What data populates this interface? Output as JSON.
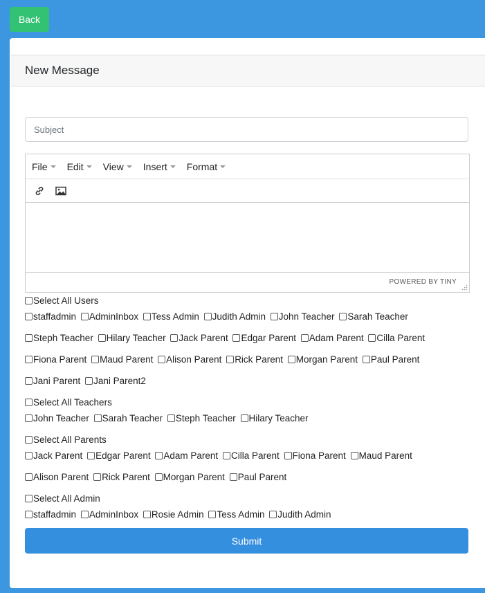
{
  "back_label": "Back",
  "card_title": "New Message",
  "subject_placeholder": "Subject",
  "editor": {
    "menus": [
      "File",
      "Edit",
      "View",
      "Insert",
      "Format"
    ],
    "tools": [
      "link-icon",
      "image-icon"
    ],
    "powered_by": "POWERED BY TINY"
  },
  "groups": {
    "all_users": {
      "select_label": "Select All Users",
      "rows": [
        [
          "staffadmin",
          "AdminInbox",
          "Tess Admin",
          "Judith Admin",
          "John Teacher",
          "Sarah Teacher"
        ],
        [
          "Steph Teacher",
          "Hilary Teacher",
          "Jack Parent",
          "Edgar Parent",
          "Adam Parent",
          "Cilla Parent"
        ],
        [
          "Fiona Parent",
          "Maud Parent",
          "Alison Parent",
          "Rick Parent",
          "Morgan Parent",
          "Paul Parent"
        ],
        [
          "Jani Parent",
          "Jani Parent2"
        ]
      ]
    },
    "teachers": {
      "select_label": "Select All Teachers",
      "rows": [
        [
          "John Teacher",
          "Sarah Teacher",
          "Steph Teacher",
          "Hilary Teacher"
        ]
      ]
    },
    "parents": {
      "select_label": "Select All Parents",
      "rows": [
        [
          "Jack Parent",
          "Edgar Parent",
          "Adam Parent",
          "Cilla Parent",
          "Fiona Parent",
          "Maud Parent"
        ],
        [
          "Alison Parent",
          "Rick Parent",
          "Morgan Parent",
          "Paul Parent"
        ]
      ]
    },
    "admin": {
      "select_label": "Select All Admin",
      "rows": [
        [
          "staffadmin",
          "AdminInbox",
          "Rosie Admin",
          "Tess Admin",
          "Judith Admin"
        ]
      ]
    }
  },
  "submit_label": "Submit",
  "colors": {
    "page_background": "#3d97e0",
    "back_button": "#33c173",
    "submit_button": "#358fdf"
  }
}
